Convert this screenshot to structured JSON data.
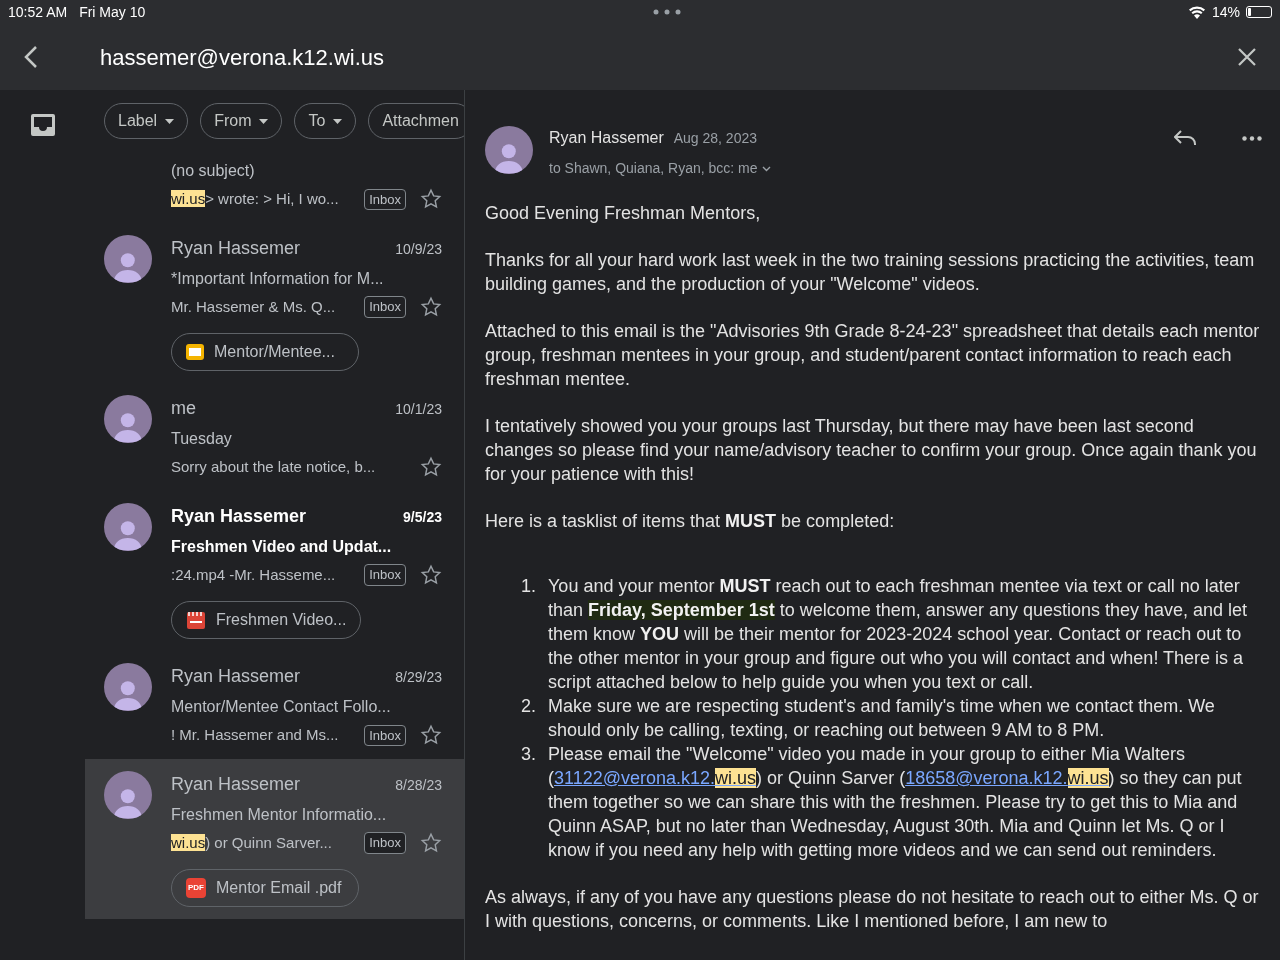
{
  "status_bar": {
    "time": "10:52 AM",
    "date": "Fri May 10",
    "battery": "14%"
  },
  "header": {
    "title": "hassemer@verona.k12.wi.us"
  },
  "filters": [
    {
      "label": "Label",
      "dropdown": true
    },
    {
      "label": "From",
      "dropdown": true
    },
    {
      "label": "To",
      "dropdown": true
    },
    {
      "label": "Attachmen",
      "dropdown": false
    }
  ],
  "messages": [
    {
      "subject": "(no subject)",
      "snippet_highlight": "wi.us",
      "snippet": "> wrote: > Hi, I wo...",
      "label": "Inbox",
      "unread": false,
      "selected": false
    },
    {
      "sender": "Ryan Hassemer",
      "date": "10/9/23",
      "subject": "*Important Information for M...",
      "snippet": "Mr. Hassemer & Ms. Q...",
      "label": "Inbox",
      "unread": false,
      "selected": false,
      "attachment": {
        "kind": "slides",
        "name": "Mentor/Mentee..."
      }
    },
    {
      "sender": "me",
      "date": "10/1/23",
      "subject": "Tuesday",
      "snippet": "Sorry about the late notice, b...",
      "unread": false,
      "selected": false
    },
    {
      "sender": "Ryan Hassemer",
      "date": "9/5/23",
      "subject": "Freshmen Video and Updat...",
      "snippet": ":24.mp4 -Mr. Hasseme...",
      "label": "Inbox",
      "unread": true,
      "selected": false,
      "attachment": {
        "kind": "video",
        "name": "Freshmen Video..."
      }
    },
    {
      "sender": "Ryan Hassemer",
      "date": "8/29/23",
      "subject": "Mentor/Mentee Contact Follo...",
      "snippet": "! Mr. Hassemer and Ms...",
      "label": "Inbox",
      "unread": false,
      "selected": false
    },
    {
      "sender": "Ryan Hassemer",
      "date": "8/28/23",
      "subject": "Freshmen Mentor Informatio...",
      "snippet_highlight": "wi.us",
      "snippet": ") or Quinn Sarver...",
      "label": "Inbox",
      "unread": false,
      "selected": true,
      "attachment": {
        "kind": "pdf",
        "badge": "PDF",
        "name": "Mentor Email .pdf"
      }
    }
  ],
  "email": {
    "sender": "Ryan Hassemer",
    "date": "Aug 28, 2023",
    "recipients": "to Shawn, Quiana, Ryan, bcc: me",
    "paragraphs": [
      [
        {
          "kind": "plain",
          "text": "Good Evening Freshman Mentors,"
        }
      ],
      [
        {
          "kind": "plain",
          "text": "Thanks for all your hard work last week in the two training sessions practicing the activities, team building games, and the production of your \"Welcome\" videos."
        }
      ],
      [
        {
          "kind": "plain",
          "text": "Attached to this email is the \"Advisories 9th Grade 8-24-23\" spreadsheet that details each mentor group, freshman mentees in your group, and student/parent contact information to reach each freshman mentee."
        }
      ],
      [
        {
          "kind": "plain",
          "text": "I tentatively showed you your groups last Thursday, but there may have been last second changes so please find your name/advisory teacher to confirm your group. Once again thank you for your patience with this!"
        }
      ],
      [
        {
          "kind": "plain",
          "text": "Here is a tasklist of items that "
        },
        {
          "kind": "bold",
          "text": "MUST"
        },
        {
          "kind": "plain",
          "text": " be completed:"
        }
      ]
    ],
    "tasks": [
      {
        "number": "1.",
        "parts": [
          {
            "kind": "plain",
            "text": "You and your mentor "
          },
          {
            "kind": "bold",
            "text": "MUST"
          },
          {
            "kind": "plain",
            "text": " reach out to each freshman mentee via text or call no later than "
          },
          {
            "kind": "mark",
            "text": "Friday, September 1st"
          },
          {
            "kind": "plain",
            "text": " to welcome them, answer any questions they have, and let them know "
          },
          {
            "kind": "bold",
            "text": "YOU"
          },
          {
            "kind": "plain",
            "text": " will be their mentor for 2023-2024 school year. Contact or reach out to the other mentor in your group and figure out who you will contact and when! There is a script attached below to help guide you when you text or call."
          }
        ]
      },
      {
        "number": "2.",
        "parts": [
          {
            "kind": "plain",
            "text": "Make sure we are respecting student's and family's time when we contact them. We should only be calling, texting, or reaching out between 9 AM to 8 PM."
          }
        ]
      },
      {
        "number": "3.",
        "parts": [
          {
            "kind": "plain",
            "text": "Please email the \"Welcome\" video you made in your group to either Mia Walters ("
          },
          {
            "kind": "link",
            "text": "31122@verona.k12.",
            "highlight": "wi.us"
          },
          {
            "kind": "plain",
            "text": ") or Quinn Sarver ("
          },
          {
            "kind": "link",
            "text": "18658@verona.k12.",
            "highlight": "wi.us"
          },
          {
            "kind": "plain",
            "text": ") so they can put them together so we can share this with the freshmen. Please try to get this to Mia and Quinn ASAP, but no later than Wednesday, August 30th. Mia and Quinn let Ms. Q or I know if you need any help with getting more videos and we can send out reminders."
          }
        ]
      }
    ],
    "closing": [
      {
        "kind": "plain",
        "text": "As always, if any of you have any questions please do not hesitate to reach out to either Ms. Q or I with questions, concerns, or comments. Like I mentioned before, I am new to"
      }
    ]
  }
}
